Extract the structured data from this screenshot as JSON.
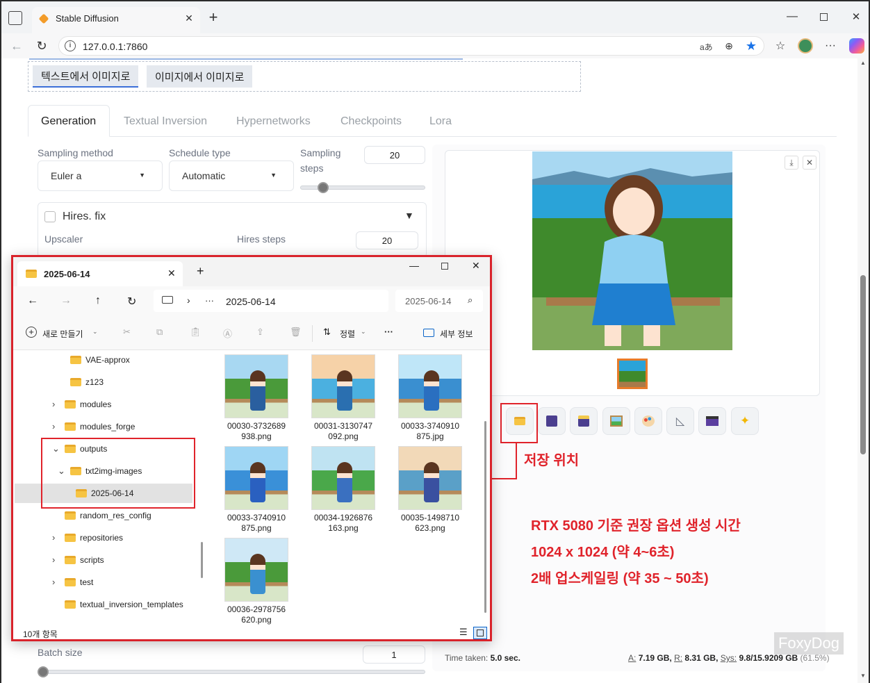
{
  "browser": {
    "tab_title": "Stable Diffusion",
    "url": "127.0.0.1:7860",
    "reader_label": "aあ",
    "new_tab": "+"
  },
  "app": {
    "mode_tabs": [
      "텍스트에서 이미지로",
      "이미지에서 이미지로"
    ],
    "gen_tabs": [
      "Generation",
      "Textual Inversion",
      "Hypernetworks",
      "Checkpoints",
      "Lora"
    ],
    "sampling_method_label": "Sampling method",
    "sampling_method_value": "Euler a",
    "schedule_type_label": "Schedule type",
    "schedule_type_value": "Automatic",
    "sampling_steps_label_1": "Sampling",
    "sampling_steps_label_2": "steps",
    "sampling_steps_value": "20",
    "sampling_steps_fraction": 0.15,
    "hires_fix_label": "Hires. fix",
    "upscaler_label": "Upscaler",
    "hires_steps_label": "Hires steps",
    "hires_steps_value": "20",
    "batch_size_label": "Batch size",
    "batch_size_value": "1",
    "batch_size_fraction": 0.0,
    "time_taken_label": "Time taken:",
    "time_taken_value": "5.0 sec.",
    "vram_a_label": "A:",
    "vram_a": "7.19 GB,",
    "vram_r_label": "R:",
    "vram_r": "8.31 GB,",
    "vram_sys_label": "Sys:",
    "vram_sys": "9.8/15.9209 GB",
    "vram_pct": "(61.5%)"
  },
  "annotations": {
    "save_location": "저장 위치",
    "line1": "RTX 5080 기준 권장 옵션 생성 시간",
    "line2": "1024 x 1024 (약 4~6초)",
    "line3": "2배 업스케일링 (약 35 ~ 50초)"
  },
  "watermark": "FoxyDog",
  "explorer": {
    "tab_title": "2025-06-14",
    "path": "2025-06-14",
    "search_placeholder": "2025-06-14",
    "ellipsis": "···",
    "new_label": "새로 만들기",
    "sort_label": "정렬",
    "details_label": "세부 정보",
    "more": "···",
    "status": "10개 항목",
    "tree": [
      {
        "name": "VAE-approx",
        "indent": 80,
        "chev": ""
      },
      {
        "name": "z123",
        "indent": 80,
        "chev": ""
      },
      {
        "name": "modules",
        "indent": 72,
        "chev": "›"
      },
      {
        "name": "modules_forge",
        "indent": 72,
        "chev": "›"
      },
      {
        "name": "outputs",
        "indent": 72,
        "chev": "⌄"
      },
      {
        "name": "txt2img-images",
        "indent": 80,
        "chev": "⌄"
      },
      {
        "name": "2025-06-14",
        "indent": 88,
        "chev": "",
        "selected": true
      },
      {
        "name": "random_res_config",
        "indent": 72,
        "chev": ""
      },
      {
        "name": "repositories",
        "indent": 72,
        "chev": "›"
      },
      {
        "name": "scripts",
        "indent": 72,
        "chev": "›"
      },
      {
        "name": "test",
        "indent": 72,
        "chev": "›"
      },
      {
        "name": "textual_inversion_templates",
        "indent": 72,
        "chev": ""
      }
    ],
    "files": [
      {
        "l1": "00030-3732689",
        "l2": "938.png"
      },
      {
        "l1": "00031-3130747",
        "l2": "092.png"
      },
      {
        "l1": "00033-3740910",
        "l2": "875.jpg"
      },
      {
        "l1": "00033-3740910",
        "l2": "875.png"
      },
      {
        "l1": "00034-1926876",
        "l2": "163.png"
      },
      {
        "l1": "00035-1498710",
        "l2": "623.png"
      },
      {
        "l1": "00036-2978756",
        "l2": "620.png"
      }
    ]
  },
  "colors": {
    "accent": "#e0232b",
    "folder": "#f6c443",
    "active_blue": "#1a73e8"
  }
}
